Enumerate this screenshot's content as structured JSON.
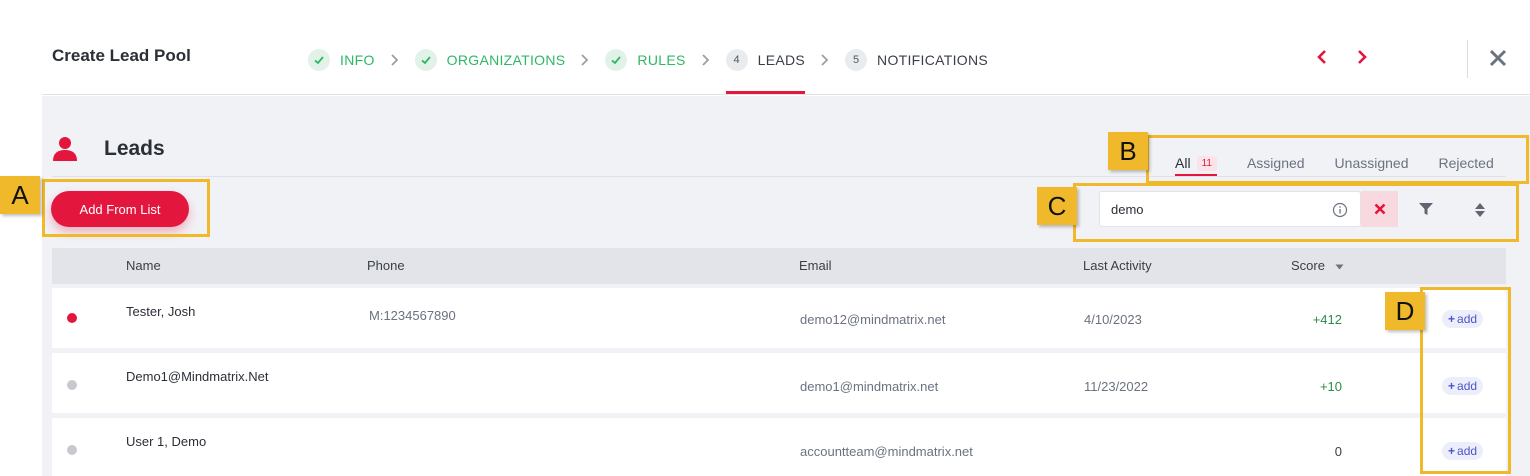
{
  "header": {
    "title": "Create Lead Pool",
    "steps": [
      {
        "label": "INFO",
        "state": "done"
      },
      {
        "label": "ORGANIZATIONS",
        "state": "done"
      },
      {
        "label": "RULES",
        "state": "done"
      },
      {
        "label": "LEADS",
        "number": "4",
        "state": "current"
      },
      {
        "label": "NOTIFICATIONS",
        "number": "5",
        "state": "todo"
      }
    ]
  },
  "section": {
    "title": "Leads"
  },
  "tabs": [
    {
      "label": "All",
      "count": "11",
      "active": true
    },
    {
      "label": "Assigned"
    },
    {
      "label": "Unassigned"
    },
    {
      "label": "Rejected"
    }
  ],
  "toolbar": {
    "add_from_list": "Add From List",
    "search_value": "demo"
  },
  "table": {
    "columns": [
      "Name",
      "Phone",
      "Email",
      "Last Activity",
      "Score"
    ],
    "rows": [
      {
        "status_color": "#e3173e",
        "name": "Tester, Josh",
        "phone": "M:1234567890",
        "email": "demo12@mindmatrix.net",
        "last_activity": "4/10/2023",
        "score": "+412",
        "action": "add"
      },
      {
        "status_color": "#c7c9ce",
        "name": "Demo1@Mindmatrix.Net",
        "phone": "",
        "email": "demo1@mindmatrix.net",
        "last_activity": "11/23/2022",
        "score": "+10",
        "action": "add"
      },
      {
        "status_color": "#c7c9ce",
        "name": "User 1, Demo",
        "phone": "",
        "email": "accountteam@mindmatrix.net",
        "last_activity": "",
        "score": "0",
        "action": "add"
      }
    ]
  },
  "annotations": {
    "a": "A",
    "b": "B",
    "c": "C",
    "d": "D"
  },
  "colors": {
    "accent": "#e3173e",
    "success": "#2fb765",
    "annotation": "#f0b92b"
  }
}
